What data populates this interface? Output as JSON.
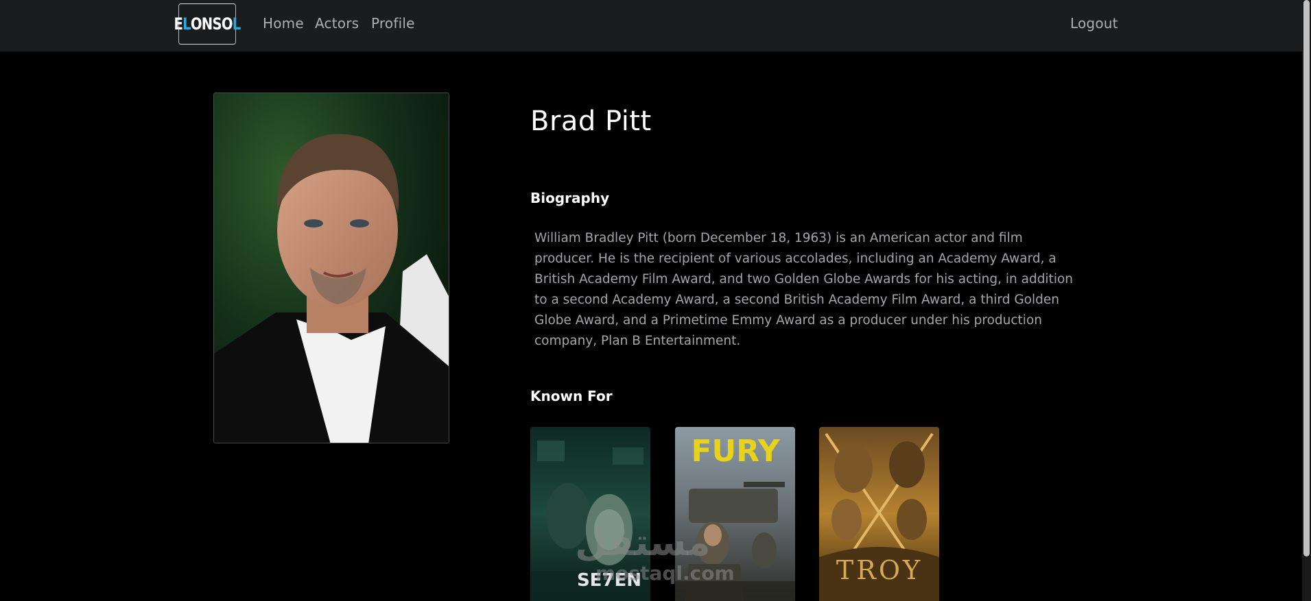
{
  "nav": {
    "logo": {
      "part1": "E",
      "part2": "L",
      "part3": "ONSO",
      "part4": "L"
    },
    "home": "Home",
    "actors": "Actors",
    "profile": "Profile",
    "logout": "Logout"
  },
  "actor": {
    "name": "Brad Pitt",
    "biography_heading": "Biography",
    "biography": "William Bradley Pitt (born December 18, 1963) is an American actor and film producer. He is the recipient of various accolades, including an Academy Award, a British Academy Film Award, and two Golden Globe Awards for his acting, in addition to a second Academy Award, a second British Academy Film Award, a third Golden Globe Award, and a Primetime Emmy Award as a producer under his production company, Plan B Entertainment.",
    "known_for_heading": "Known For"
  },
  "known_for": [
    {
      "poster_text": "SE7EN"
    },
    {
      "poster_text": "FURY"
    },
    {
      "poster_text": "TROY"
    }
  ],
  "watermark": {
    "arabic": "مستقل",
    "latin": "mostaql.com"
  },
  "colors": {
    "navbar_bg": "#1b1c1e",
    "page_bg": "#000000",
    "logo_accent": "#27a9e1",
    "nav_text": "#aeb0b3",
    "bio_text": "#a3a6aa"
  }
}
